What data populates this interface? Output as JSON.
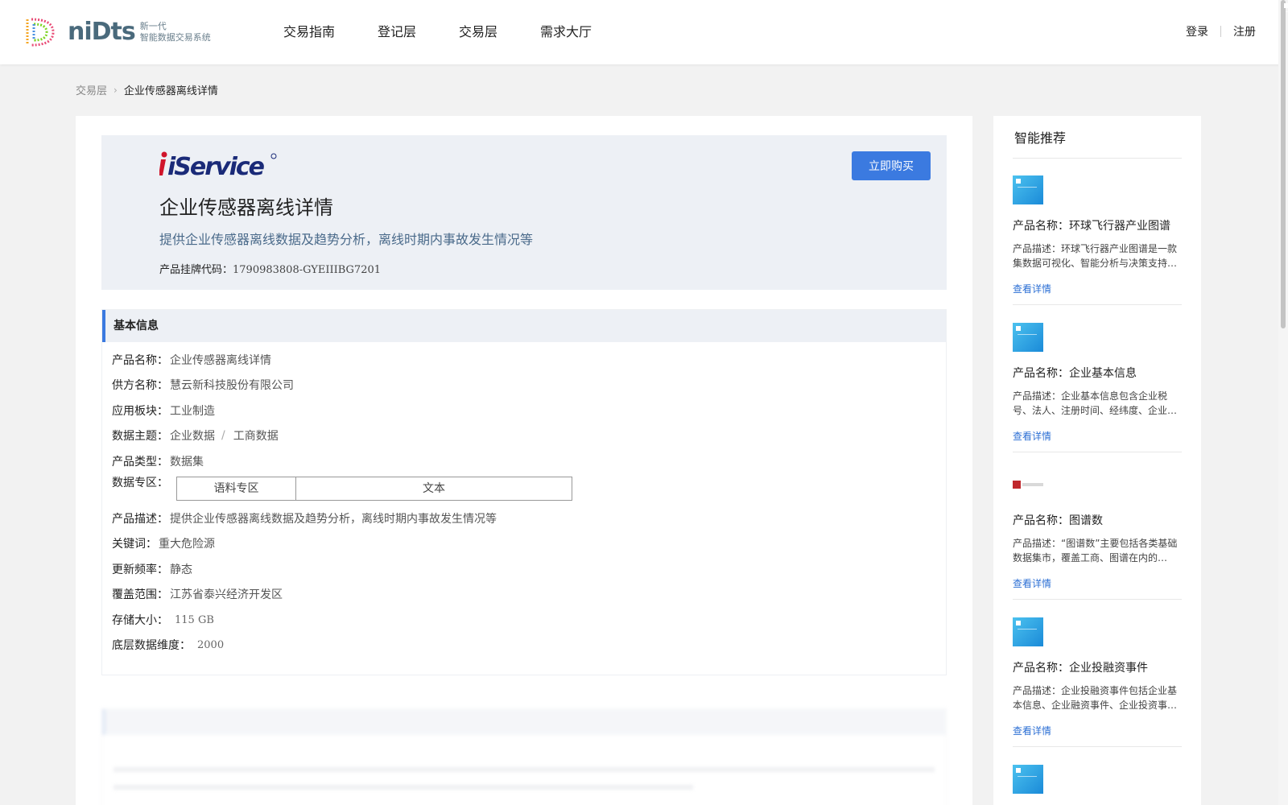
{
  "brand": {
    "name": "niDts",
    "tagline_line1": "新一代",
    "tagline_line2": "智能数据交易系统"
  },
  "nav": [
    "交易指南",
    "登记层",
    "交易层",
    "需求大厅"
  ],
  "auth": {
    "login": "登录",
    "register": "注册"
  },
  "breadcrumb": {
    "parent": "交易层",
    "current": "企业传感器离线详情"
  },
  "hero": {
    "vendor_logo": "iService",
    "title": "企业传感器离线详情",
    "description": "提供企业传感器离线数据及趋势分析，离线时期内事故发生情况等",
    "code_label": "产品挂牌代码：",
    "code_value": "1790983808-GYEIIIBG7201",
    "buy_label": "立即购买"
  },
  "basic_info": {
    "heading": "基本信息",
    "fields": {
      "product_name": {
        "label": "产品名称：",
        "value": "企业传感器离线详情"
      },
      "supplier": {
        "label": "供方名称：",
        "value": "慧云新科技股份有限公司"
      },
      "sector": {
        "label": "应用板块：",
        "value": "工业制造"
      },
      "topic": {
        "label": "数据主题：",
        "value1": "企业数据",
        "sep": "/",
        "value2": "工商数据"
      },
      "type": {
        "label": "产品类型：",
        "value": "数据集"
      },
      "zone": {
        "label": "数据专区：",
        "col1": "语料专区",
        "col2": "文本"
      },
      "desc": {
        "label": "产品描述：",
        "value": "提供企业传感器离线数据及趋势分析，离线时期内事故发生情况等"
      },
      "keywords": {
        "label": "关键词：",
        "value": "重大危险源"
      },
      "frequency": {
        "label": "更新频率：",
        "value": "静态"
      },
      "coverage": {
        "label": "覆盖范围：",
        "value": "江苏省泰兴经济开发区"
      },
      "storage": {
        "label": "存储大小：",
        "value": "115 GB"
      },
      "dimension": {
        "label": "底层数据维度：",
        "value": "2000"
      }
    }
  },
  "recommend": {
    "title": "智能推荐",
    "items": [
      {
        "name": "产品名称：环球飞行器产业图谱",
        "desc": "产品描述：环球飞行器产业图谱是一款集数据可视化、智能分析与决策支持…",
        "link": "查看详情",
        "thumb": "blue"
      },
      {
        "name": "产品名称：企业基本信息",
        "desc": "产品描述：企业基本信息包含企业税号、法人、注册时间、经纬度、企业…",
        "link": "查看详情",
        "thumb": "blue"
      },
      {
        "name": "产品名称：图谱数",
        "desc": "产品描述：“图谱数”主要包括各类基础数据集市，覆盖工商、图谱在内的…",
        "link": "查看详情",
        "thumb": "red"
      },
      {
        "name": "产品名称：企业投融资事件",
        "desc": "产品描述：企业投融资事件包括企业基本信息、企业融资事件、企业投资事…",
        "link": "查看详情",
        "thumb": "blue"
      }
    ]
  },
  "colors": {
    "accent": "#3b7ae0",
    "link": "#2c6fd4",
    "hero_bg": "#edf0f5",
    "page_bg": "#f2f2f2"
  }
}
